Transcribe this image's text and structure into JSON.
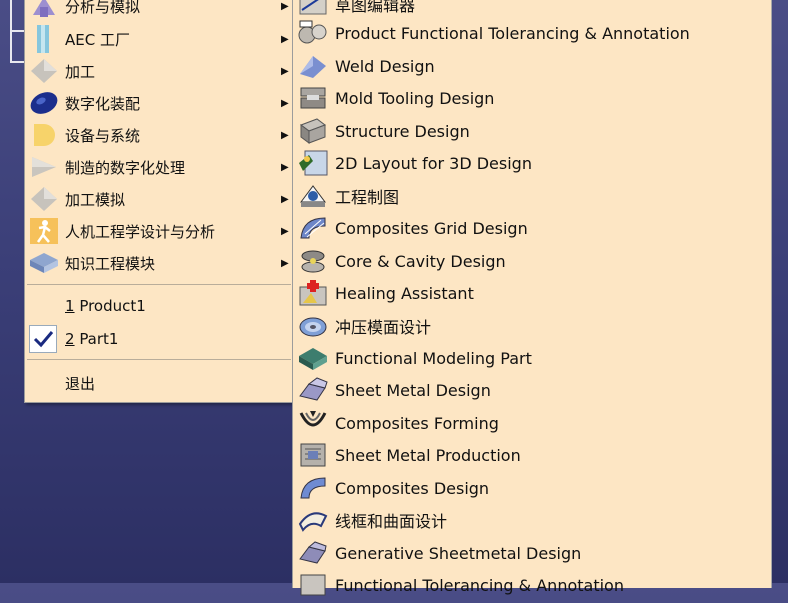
{
  "menu1": {
    "items": [
      {
        "label": "分析与模拟",
        "icon": "analysis-simulation-icon",
        "has_submenu": true
      },
      {
        "label": "AEC 工厂",
        "icon": "aec-plant-icon",
        "has_submenu": true
      },
      {
        "label": "加工",
        "icon": "machining-icon",
        "has_submenu": true
      },
      {
        "label": "数字化装配",
        "icon": "digital-mockup-icon",
        "has_submenu": true
      },
      {
        "label": "设备与系统",
        "icon": "equipment-systems-icon",
        "has_submenu": true
      },
      {
        "label": "制造的数字化处理",
        "icon": "digital-process-manufacturing-icon",
        "has_submenu": true
      },
      {
        "label": "加工模拟",
        "icon": "machining-simulation-icon",
        "has_submenu": true
      },
      {
        "label": "人机工程学设计与分析",
        "icon": "ergonomics-icon",
        "has_submenu": true
      },
      {
        "label": "知识工程模块",
        "icon": "knowledgeware-icon",
        "has_submenu": true
      }
    ],
    "recent": [
      {
        "number": "1",
        "label": " Product1",
        "checked": false
      },
      {
        "number": "2",
        "label": " Part1",
        "checked": true
      }
    ],
    "exit_label": "退出"
  },
  "menu2": {
    "items": [
      {
        "label": "草图编辑器",
        "icon": "sketcher-icon"
      },
      {
        "label": "Product Functional Tolerancing & Annotation",
        "icon": "product-tolerancing-icon"
      },
      {
        "label": "Weld Design",
        "icon": "weld-design-icon"
      },
      {
        "label": "Mold Tooling Design",
        "icon": "mold-tooling-icon"
      },
      {
        "label": "Structure Design",
        "icon": "structure-design-icon"
      },
      {
        "label": "2D Layout for 3D Design",
        "icon": "2d-layout-icon"
      },
      {
        "label": "工程制图",
        "icon": "drafting-icon"
      },
      {
        "label": "Composites Grid Design",
        "icon": "composites-grid-icon"
      },
      {
        "label": "Core & Cavity Design",
        "icon": "core-cavity-icon"
      },
      {
        "label": "Healing Assistant",
        "icon": "healing-assistant-icon"
      },
      {
        "label": "冲压模面设计",
        "icon": "die-face-design-icon"
      },
      {
        "label": "Functional Modeling Part",
        "icon": "functional-modeling-icon"
      },
      {
        "label": "Sheet Metal Design",
        "icon": "sheet-metal-design-icon"
      },
      {
        "label": "Composites Forming",
        "icon": "composites-forming-icon"
      },
      {
        "label": "Sheet Metal Production",
        "icon": "sheet-metal-production-icon"
      },
      {
        "label": "Composites Design",
        "icon": "composites-design-icon"
      },
      {
        "label": "线框和曲面设计",
        "icon": "wireframe-surface-icon"
      },
      {
        "label": "Generative Sheetmetal Design",
        "icon": "generative-sheetmetal-icon"
      },
      {
        "label": "Functional Tolerancing & Annotation",
        "icon": "functional-tolerancing-icon"
      }
    ]
  }
}
